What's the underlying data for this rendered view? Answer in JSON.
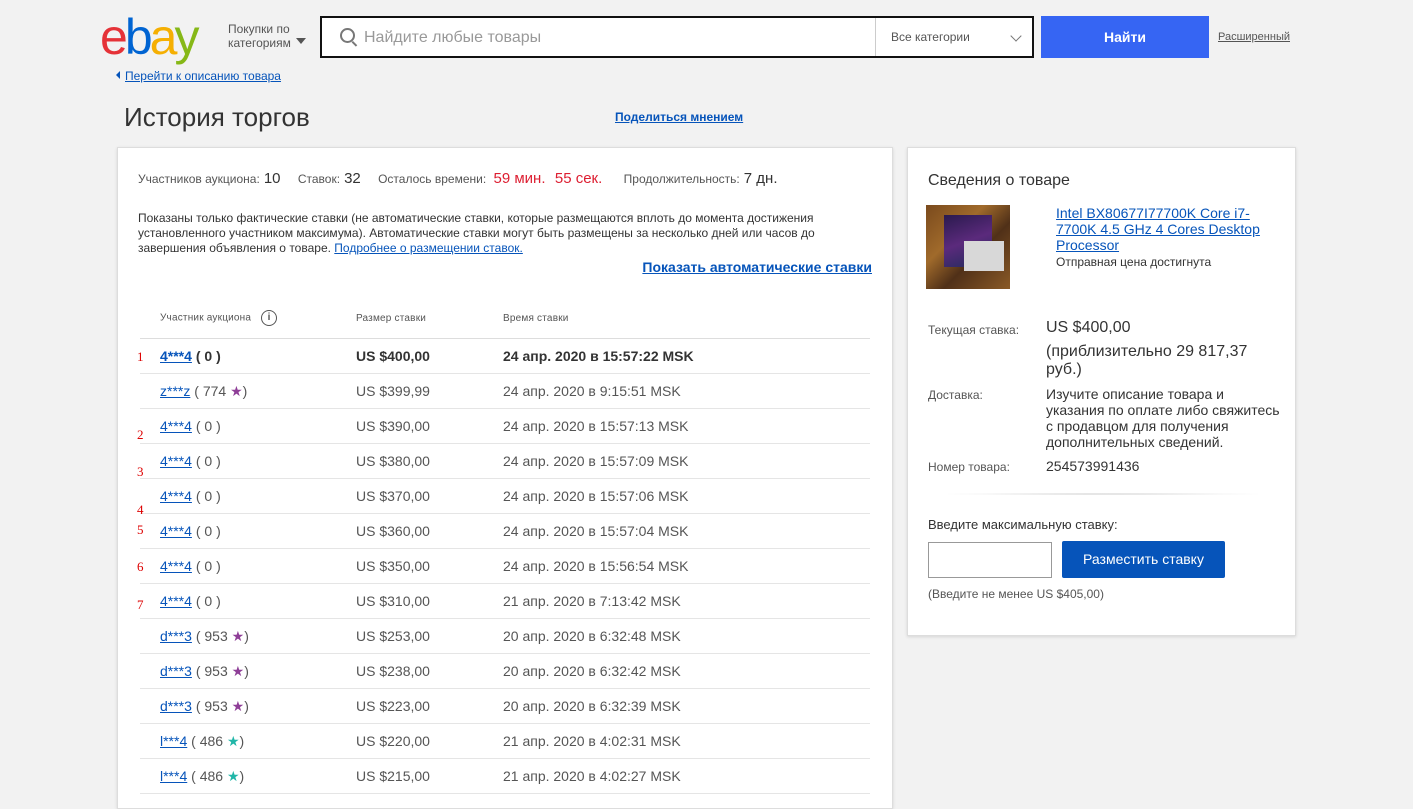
{
  "header": {
    "logo_letters": [
      "e",
      "b",
      "a",
      "y"
    ],
    "logo_colors": [
      "#e53238",
      "#0064d2",
      "#f5af02",
      "#86b817"
    ],
    "shop_by_line1": "Покупки по",
    "shop_by_line2": "категориям",
    "search_placeholder": "Найдите любые товары",
    "category": "Все категории",
    "find_button": "Найти",
    "advanced_link": "Расширенный"
  },
  "back_link": "Перейти к описанию товара",
  "page_title": "История торгов",
  "share_link": "Поделиться мнением",
  "stats": {
    "bidders_label": "Участников аукциона:",
    "bidders_value": "10",
    "bids_label": "Ставок:",
    "bids_value": "32",
    "time_left_label": "Осталось времени:",
    "time_left_minutes": "59 мин.",
    "time_left_seconds": "55 сек.",
    "duration_label": "Продолжительность:",
    "duration_value": "7 дн."
  },
  "note_text": "Показаны только фактические ставки (не автоматические ставки, которые размещаются вплоть до момента достижения установленного участником максимума). Автоматические ставки могут быть размещены за несколько дней или часов до завершения объявления о товаре.",
  "note_link": "Подробнее о размещении ставок.",
  "show_auto_link": "Показать автоматические ставки",
  "table": {
    "col_bidder": "Участник аукциона",
    "col_amount": "Размер ставки",
    "col_time": "Время ставки",
    "rows": [
      {
        "bidder": "4***4",
        "score": "0",
        "star": "",
        "amount": "US $400,00",
        "time": "24 апр. 2020 в 15:57:22 MSK"
      },
      {
        "bidder": "z***z",
        "score": "774",
        "star": "★",
        "amount": "US $399,99",
        "time": "24 апр. 2020 в 9:15:51 MSK"
      },
      {
        "bidder": "4***4",
        "score": "0",
        "star": "",
        "amount": "US $390,00",
        "time": "24 апр. 2020 в 15:57:13 MSK"
      },
      {
        "bidder": "4***4",
        "score": "0",
        "star": "",
        "amount": "US $380,00",
        "time": "24 апр. 2020 в 15:57:09 MSK"
      },
      {
        "bidder": "4***4",
        "score": "0",
        "star": "",
        "amount": "US $370,00",
        "time": "24 апр. 2020 в 15:57:06 MSK"
      },
      {
        "bidder": "4***4",
        "score": "0",
        "star": "",
        "amount": "US $360,00",
        "time": "24 апр. 2020 в 15:57:04 MSK"
      },
      {
        "bidder": "4***4",
        "score": "0",
        "star": "",
        "amount": "US $350,00",
        "time": "24 апр. 2020 в 15:56:54 MSK"
      },
      {
        "bidder": "4***4",
        "score": "0",
        "star": "",
        "amount": "US $310,00",
        "time": "21 апр. 2020 в 7:13:42 MSK"
      },
      {
        "bidder": "d***3",
        "score": "953",
        "star": "★",
        "amount": "US $253,00",
        "time": "20 апр. 2020 в 6:32:48 MSK"
      },
      {
        "bidder": "d***3",
        "score": "953",
        "star": "★",
        "amount": "US $238,00",
        "time": "20 апр. 2020 в 6:32:42 MSK"
      },
      {
        "bidder": "d***3",
        "score": "953",
        "star": "★",
        "amount": "US $223,00",
        "time": "20 апр. 2020 в 6:32:39 MSK"
      },
      {
        "bidder": "l***4",
        "score": "486",
        "star": "★",
        "amount": "US $220,00",
        "time": "21 апр. 2020 в 4:02:31 MSK"
      },
      {
        "bidder": "l***4",
        "score": "486",
        "star": "★",
        "amount": "US $215,00",
        "time": "21 апр. 2020 в 4:02:27 MSK"
      }
    ],
    "star_colors": {
      "z***z": "#8e3e97",
      "d***3": "#8e3e97",
      "l***4": "#21b6a8"
    }
  },
  "annotations": [
    "1",
    "2",
    "3",
    "4",
    "5",
    "6",
    "7"
  ],
  "item": {
    "panel_title": "Сведения о товаре",
    "title": "Intel BX80677I77700K Core i7-7700K 4.5 GHz 4 Cores Desktop Processor",
    "reserve": "Отправная цена достигнута",
    "current_bid_label": "Текущая ставка:",
    "current_bid": "US $400,00",
    "approx": "(приблизительно 29 817,37 руб.)",
    "shipping_label": "Доставка:",
    "shipping": "Изучите описание товара и указания по оплате либо свяжитесь с продавцом для получения дополнительных сведений.",
    "item_number_label": "Номер товара:",
    "item_number": "254573991436",
    "max_bid_label": "Введите максимальную ставку:",
    "place_bid_button": "Разместить ставку",
    "min_bid_note": "(Введите не менее US $405,00)"
  }
}
